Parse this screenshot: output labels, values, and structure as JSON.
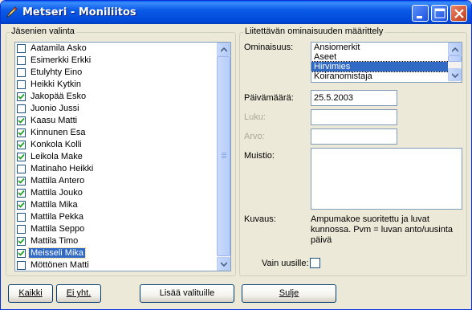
{
  "window": {
    "title": "Metseri - Moniliitos",
    "controls": [
      "minimize-icon",
      "maximize-icon",
      "close-icon"
    ]
  },
  "members_group": {
    "legend": "Jäsenien valinta",
    "items": [
      {
        "name": "Aatamila Asko",
        "checked": false,
        "selected": false
      },
      {
        "name": "Esimerkki Erkki",
        "checked": false,
        "selected": false
      },
      {
        "name": "Etulyhty Eino",
        "checked": false,
        "selected": false
      },
      {
        "name": "Heikki Kytkin",
        "checked": false,
        "selected": false
      },
      {
        "name": "Jakopää Esko",
        "checked": true,
        "selected": false
      },
      {
        "name": "Juonio Jussi",
        "checked": false,
        "selected": false
      },
      {
        "name": "Kaasu Matti",
        "checked": true,
        "selected": false
      },
      {
        "name": "Kinnunen Esa",
        "checked": true,
        "selected": false
      },
      {
        "name": "Konkola Kolli",
        "checked": true,
        "selected": false
      },
      {
        "name": "Leikola Make",
        "checked": true,
        "selected": false
      },
      {
        "name": "Matinaho Heikki",
        "checked": false,
        "selected": false
      },
      {
        "name": "Mattila Antero",
        "checked": true,
        "selected": false
      },
      {
        "name": "Mattila Jouko",
        "checked": true,
        "selected": false
      },
      {
        "name": "Mattila Mika",
        "checked": true,
        "selected": false
      },
      {
        "name": "Mattila Pekka",
        "checked": false,
        "selected": false
      },
      {
        "name": "Mattila Seppo",
        "checked": false,
        "selected": false
      },
      {
        "name": "Mattila Timo",
        "checked": true,
        "selected": false
      },
      {
        "name": "Meisseli Mika",
        "checked": true,
        "selected": true
      },
      {
        "name": "Möttönen Matti",
        "checked": false,
        "selected": false
      }
    ]
  },
  "attribute_group": {
    "legend": "Liitettävän ominaisuuden määrittely",
    "ominaisuus_label": "Ominaisuus:",
    "ominaisuus_options": [
      {
        "label": "Ansiomerkit",
        "selected": false
      },
      {
        "label": "Aseet",
        "selected": false
      },
      {
        "label": "Hirvimies",
        "selected": true
      },
      {
        "label": "Koiranomistaja",
        "selected": false
      }
    ],
    "paivamaara_label": "Päivämäärä:",
    "paivamaara_value": "25.5.2003",
    "luku_label": "Luku:",
    "arvo_label": "Arvo:",
    "muistio_label": "Muistio:",
    "kuvaus_label": "Kuvaus:",
    "kuvaus_text": "Ampumakoe suoritettu ja luvat kunnossa. Pvm = luvan anto/uusinta päivä",
    "vain_uusille_label": "Vain uusille:",
    "vain_uusille_checked": false
  },
  "buttons": {
    "kaikki": "Kaikki",
    "ei_yht": "Ei yht.",
    "lisaa": "Lisää valituille",
    "sulje": "Sulje"
  },
  "colors": {
    "selection": "#316ac5",
    "titlebar": "#0b5ae8",
    "window_bg": "#ece9d8"
  }
}
